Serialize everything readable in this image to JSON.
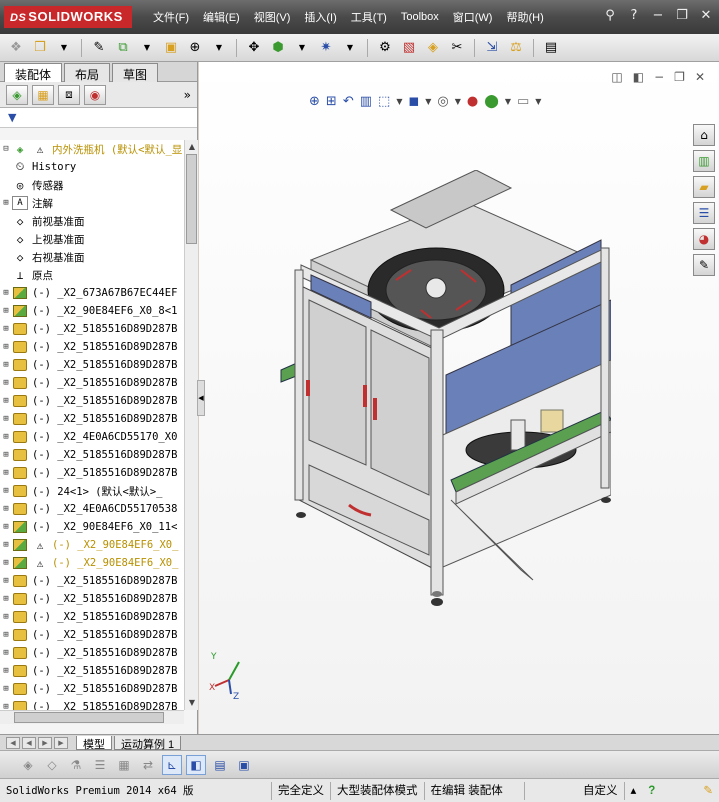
{
  "titlebar": {
    "logo": "SOLIDWORKS",
    "menus": [
      "文件(F)",
      "编辑(E)",
      "视图(V)",
      "插入(I)",
      "工具(T)",
      "Toolbox",
      "窗口(W)",
      "帮助(H)"
    ],
    "icons": [
      "pin-icon",
      "help-icon",
      "minimize-icon",
      "restore-icon",
      "close-icon"
    ]
  },
  "leftpane": {
    "tabs": [
      "装配体",
      "布局",
      "草图"
    ],
    "tree": [
      {
        "label": "内外洗瓶机  (默认<默认_显",
        "icon": "assembly",
        "warn": true,
        "expand": "⊟"
      },
      {
        "label": "History",
        "icon": "history"
      },
      {
        "label": "传感器",
        "icon": "sensor"
      },
      {
        "label": "注解",
        "icon": "annotation",
        "expand": "⊞"
      },
      {
        "label": "前视基准面",
        "icon": "plane"
      },
      {
        "label": "上视基准面",
        "icon": "plane"
      },
      {
        "label": "右视基准面",
        "icon": "plane"
      },
      {
        "label": "原点",
        "icon": "origin"
      },
      {
        "label": "(-) _X2_673A67B67EC44EF",
        "icon": "asm",
        "expand": "⊞"
      },
      {
        "label": "(-) _X2_90E84EF6_X0_8<1",
        "icon": "asm",
        "expand": "⊞"
      },
      {
        "label": "(-) _X2_5185516D89D287B",
        "icon": "part",
        "expand": "⊞"
      },
      {
        "label": "(-) _X2_5185516D89D287B",
        "icon": "part",
        "expand": "⊞"
      },
      {
        "label": "(-) _X2_5185516D89D287B",
        "icon": "part",
        "expand": "⊞"
      },
      {
        "label": "(-) _X2_5185516D89D287B",
        "icon": "part",
        "expand": "⊞"
      },
      {
        "label": "(-) _X2_5185516D89D287B",
        "icon": "part",
        "expand": "⊞"
      },
      {
        "label": "(-) _X2_5185516D89D287B",
        "icon": "part",
        "expand": "⊞"
      },
      {
        "label": "(-) _X2_4E0A6CD55170_X0",
        "icon": "part",
        "expand": "⊞"
      },
      {
        "label": "(-) _X2_5185516D89D287B",
        "icon": "part",
        "expand": "⊞"
      },
      {
        "label": "(-) _X2_5185516D89D287B",
        "icon": "part",
        "expand": "⊞"
      },
      {
        "label": "(-) 24<1> (默认<默认>_",
        "icon": "part",
        "expand": "⊞"
      },
      {
        "label": "(-) _X2_4E0A6CD55170538",
        "icon": "part",
        "expand": "⊞"
      },
      {
        "label": "(-) _X2_90E84EF6_X0_11<",
        "icon": "asm",
        "expand": "⊞"
      },
      {
        "label": "(-) _X2_90E84EF6_X0_",
        "icon": "asm",
        "warn": true,
        "expand": "⊞"
      },
      {
        "label": "(-) _X2_90E84EF6_X0_",
        "icon": "asm",
        "warn": true,
        "expand": "⊞"
      },
      {
        "label": "(-) _X2_5185516D89D287B",
        "icon": "part",
        "expand": "⊞"
      },
      {
        "label": "(-) _X2_5185516D89D287B",
        "icon": "part",
        "expand": "⊞"
      },
      {
        "label": "(-) _X2_5185516D89D287B",
        "icon": "part",
        "expand": "⊞"
      },
      {
        "label": "(-) _X2_5185516D89D287B",
        "icon": "part",
        "expand": "⊞"
      },
      {
        "label": "(-) _X2_5185516D89D287B",
        "icon": "part",
        "expand": "⊞"
      },
      {
        "label": "(-) _X2_5185516D89D287B",
        "icon": "part",
        "expand": "⊞"
      },
      {
        "label": "(-) _X2_5185516D89D287B",
        "icon": "part",
        "expand": "⊞"
      },
      {
        "label": "(-) _X2_5185516D89D287B",
        "icon": "part",
        "expand": "⊞"
      }
    ]
  },
  "viewport": {
    "triad": {
      "x": "X",
      "y": "Y",
      "z": "Z"
    }
  },
  "bottom_tabs": [
    "模型",
    "运动算例 1"
  ],
  "status": {
    "version": "SolidWorks Premium 2014 x64 版",
    "defined": "完全定义",
    "mode": "大型装配体模式",
    "editing": "在编辑 装配体",
    "custom": "自定义"
  },
  "colors": {
    "accent": "#2a4ea8",
    "logo": "#c8282a",
    "warn": "#b89000"
  }
}
